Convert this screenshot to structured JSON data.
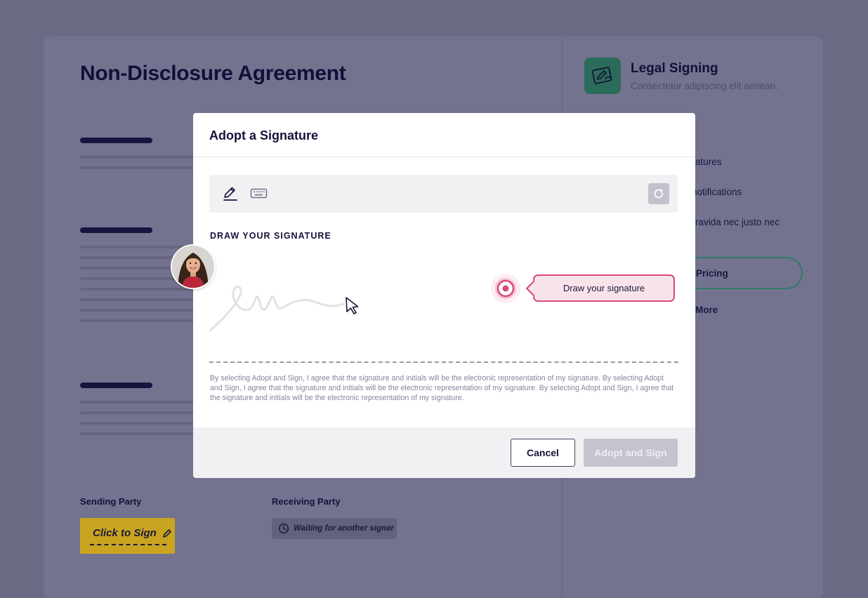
{
  "document": {
    "title": "Non-Disclosure Agreement",
    "sending_party_label": "Sending Party",
    "receiving_party_label": "Receiving Party",
    "click_to_sign_label": "Click to Sign",
    "waiting_label": "Waiting for another signer"
  },
  "sidebar": {
    "app_name": "Legal Signing",
    "app_description": "Consectetur adipiscing elit aenean.",
    "feature_1": "atures",
    "feature_2": "notifications",
    "feature_3": "ravida nec justo nec",
    "pricing_label": "Pricing",
    "more_label": "More"
  },
  "modal": {
    "title": "Adopt a Signature",
    "draw_heading": "DRAW YOUR SIGNATURE",
    "tooltip": "Draw your signature",
    "legal_text": "By selecting Adopt and Sign, I agree that the signature and initials will be the electronic representation of my signature. By selecting Adopt and Sign, I agree that the signature and initials will be the electronic representation of my signature. By selecting Adopt and Sign, I agree that the signature and initials will be the electronic representation of my signature.",
    "cancel_label": "Cancel",
    "adopt_label": "Adopt and Sign",
    "tools": [
      "pencil-icon",
      "keyboard-icon",
      "refresh-icon"
    ]
  },
  "colors": {
    "overlay": "#6a6a85",
    "accent_pink": "#d9497c",
    "click_to_sign": "#c9a421",
    "brand_green": "#2b6b5a"
  }
}
